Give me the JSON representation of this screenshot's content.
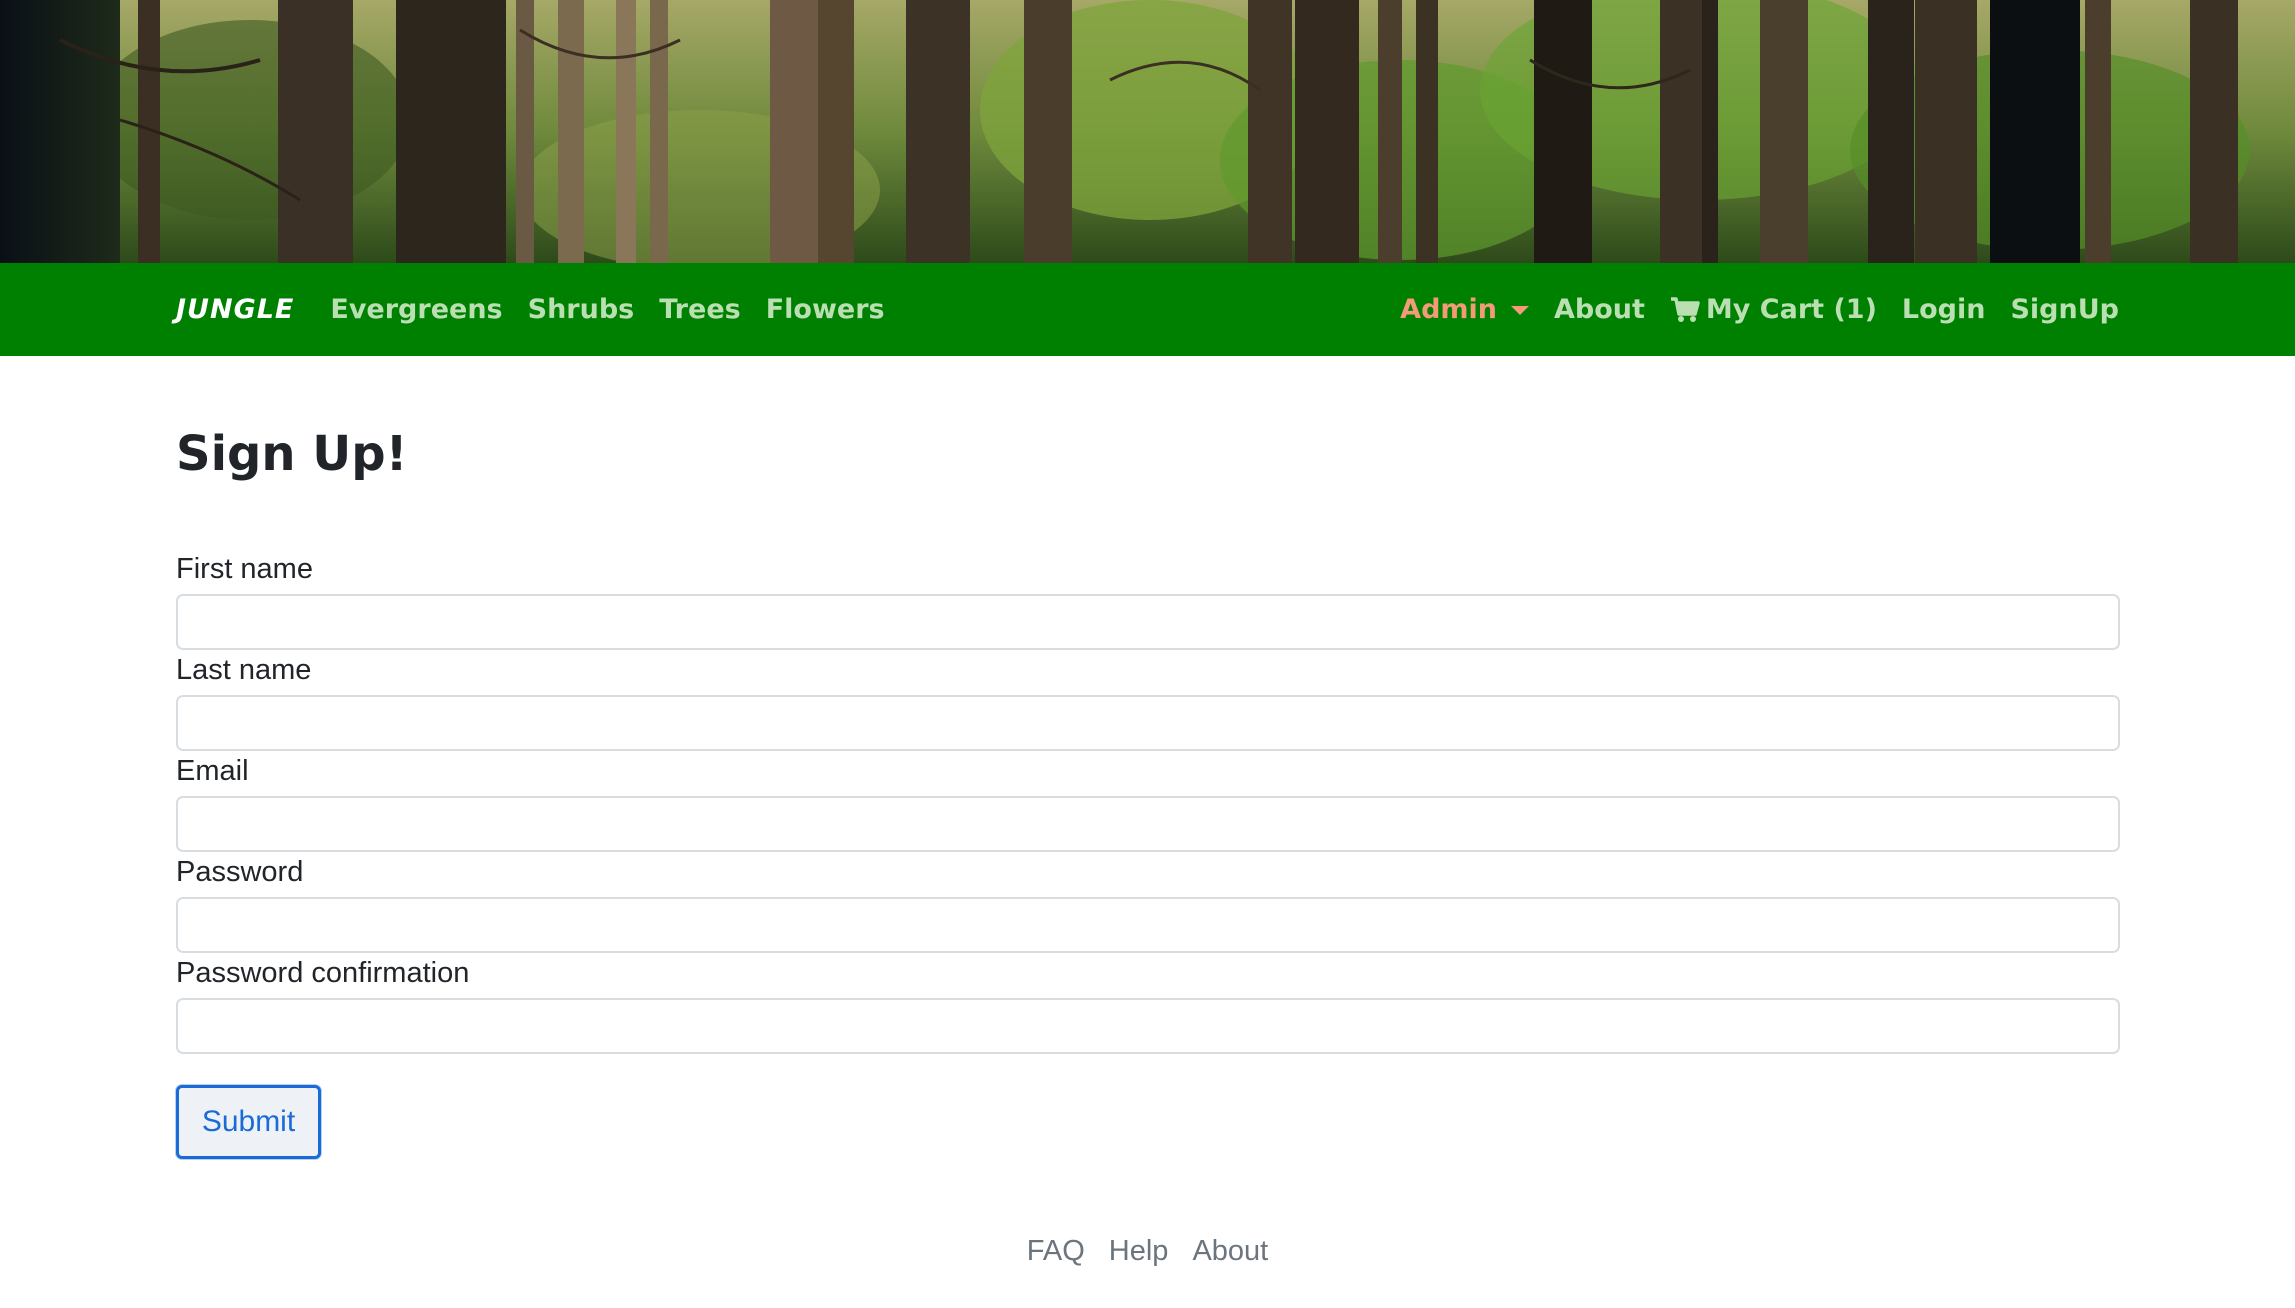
{
  "brand": {
    "name": "JUNGLE"
  },
  "nav": {
    "left": [
      {
        "label": "Evergreens"
      },
      {
        "label": "Shrubs"
      },
      {
        "label": "Trees"
      },
      {
        "label": "Flowers"
      }
    ],
    "admin_label": "Admin",
    "about_label": "About",
    "cart_label": "My Cart (1)",
    "login_label": "Login",
    "signup_label": "SignUp"
  },
  "page": {
    "title": "Sign Up!"
  },
  "form": {
    "fields": [
      {
        "label": "First name",
        "value": ""
      },
      {
        "label": "Last name",
        "value": ""
      },
      {
        "label": "Email",
        "value": ""
      },
      {
        "label": "Password",
        "value": ""
      },
      {
        "label": "Password confirmation",
        "value": ""
      }
    ],
    "submit_label": "Submit"
  },
  "footer": {
    "links": [
      {
        "label": "FAQ"
      },
      {
        "label": "Help"
      },
      {
        "label": "About"
      }
    ]
  },
  "colors": {
    "navbar": "#008000",
    "nav_link": "#b9dfb2",
    "admin_link": "#f49a79",
    "submit_border": "#1a6bd6",
    "footer_link": "#6c757d"
  },
  "icons": {
    "cart": "shopping-cart-icon",
    "admin_dropdown": "caret-down-icon"
  }
}
